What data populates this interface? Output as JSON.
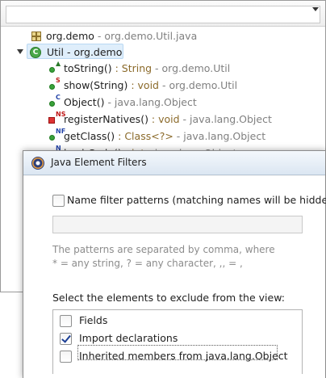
{
  "outline": {
    "filter_placeholder": "",
    "items": [
      {
        "name": "org.demo",
        "detail": " - org.demo.Util.java"
      },
      {
        "name": "Util",
        "detail": " - org.demo"
      },
      {
        "name": "toString()",
        "type": " : String",
        "detail": " - org.demo.Util"
      },
      {
        "name": "show(String)",
        "type": " : void",
        "detail": " - org.demo.Util"
      },
      {
        "name": "Object()",
        "detail": " - java.lang.Object"
      },
      {
        "name": "registerNatives()",
        "type": " : void",
        "detail": " - java.lang.Object"
      },
      {
        "name": "getClass()",
        "type": " : Class<?>",
        "detail": " - java.lang.Object"
      },
      {
        "name": "hashCode()",
        "type": " : int",
        "detail": " - java.lang.Object"
      }
    ]
  },
  "dialog": {
    "title": "Java Element Filters",
    "name_filter_label": "Name filter patterns (matching names will be hidden):",
    "name_filter_checked": false,
    "pattern_value": "",
    "hint_line1": "The patterns are separated by comma, where",
    "hint_line2": "* = any string, ? = any character, ,, = ,",
    "exclude_label": "Select the elements to exclude from the view:",
    "options": [
      {
        "label": "Fields",
        "checked": false
      },
      {
        "label": "Import declarations",
        "checked": true
      },
      {
        "label": "Inherited members from java.lang.Object",
        "checked": false
      }
    ]
  },
  "colors": {
    "selection": "#dfeefb",
    "type_text": "#8b6a2a",
    "muted_text": "#808080"
  }
}
